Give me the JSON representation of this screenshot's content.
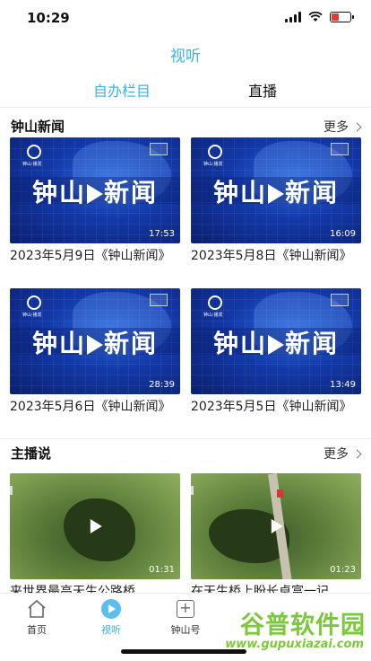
{
  "status_bar": {
    "time": "10:29"
  },
  "header": {
    "title": "视听"
  },
  "tabs": [
    {
      "label": "自办栏目",
      "active": true
    },
    {
      "label": "直播",
      "active": false
    }
  ],
  "sections": {
    "news": {
      "title": "钟山新闻",
      "more_label": "更多",
      "thumb_text": "钟山新闻",
      "logo_caption": "钟山·播发",
      "items": [
        {
          "title": "2023年5月9日《钟山新闻》",
          "duration": "17:53"
        },
        {
          "title": "2023年5月8日《钟山新闻》",
          "duration": "16:09"
        },
        {
          "title": "2023年5月6日《钟山新闻》",
          "duration": "28:39"
        },
        {
          "title": "2023年5月5日《钟山新闻》",
          "duration": "13:49"
        }
      ]
    },
    "anchor": {
      "title": "主播说",
      "more_label": "更多",
      "items": [
        {
          "title": "来世界最高天生公路桥",
          "duration": "01:31"
        },
        {
          "title": "在天生桥上盼长卓富一记",
          "duration": "01:23"
        }
      ]
    }
  },
  "bottom_nav": [
    {
      "label": "首页",
      "icon": "home-icon",
      "active": false
    },
    {
      "label": "视听",
      "icon": "play-circle-icon",
      "active": true
    },
    {
      "label": "钟山号",
      "icon": "plus-square-icon",
      "active": false
    }
  ],
  "watermark": {
    "text": "谷普软件园",
    "url": "www.gupuxiazai.com"
  },
  "colors": {
    "accent": "#3ab2ea",
    "watermark": "#7cc83a"
  }
}
